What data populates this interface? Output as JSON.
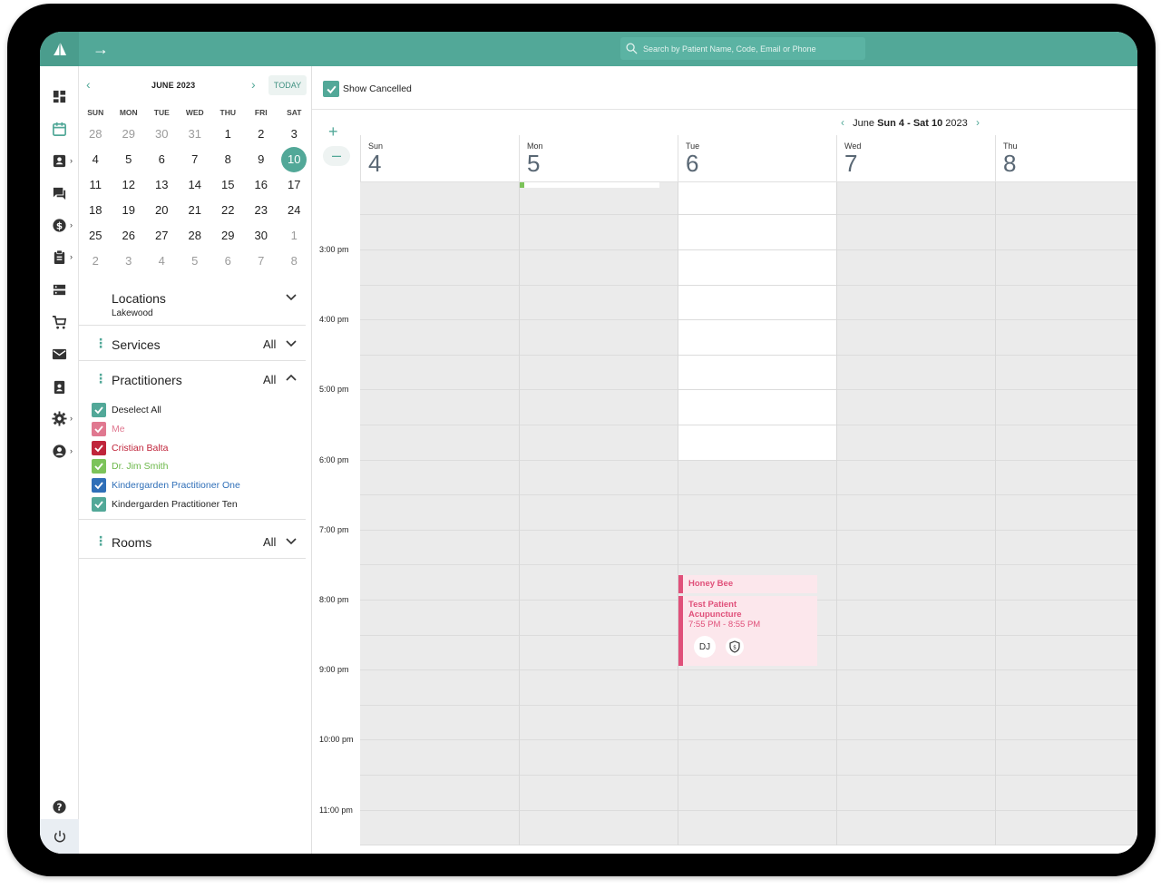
{
  "header": {
    "search_placeholder": "Search by Patient Name, Code, Email or Phone"
  },
  "rail": {
    "icons": [
      "dashboard-icon",
      "calendar-icon",
      "contacts-icon",
      "chat-icon",
      "billing-icon",
      "clipboard-icon",
      "server-icon",
      "cart-icon",
      "mail-icon",
      "badge-icon",
      "gear-icon",
      "account-icon"
    ],
    "help_icon": "help-icon",
    "power_icon": "power-icon"
  },
  "calendar": {
    "month_label": "JUNE 2023",
    "today_label": "TODAY",
    "weekdays": [
      "SUN",
      "MON",
      "TUE",
      "WED",
      "THU",
      "FRI",
      "SAT"
    ],
    "weeks": [
      [
        "28",
        "29",
        "30",
        "31",
        "1",
        "2",
        "3"
      ],
      [
        "4",
        "5",
        "6",
        "7",
        "8",
        "9",
        "10"
      ],
      [
        "11",
        "12",
        "13",
        "14",
        "15",
        "16",
        "17"
      ],
      [
        "18",
        "19",
        "20",
        "21",
        "22",
        "23",
        "24"
      ],
      [
        "25",
        "26",
        "27",
        "28",
        "29",
        "30",
        "1"
      ],
      [
        "2",
        "3",
        "4",
        "5",
        "6",
        "7",
        "8"
      ]
    ],
    "selected": "10"
  },
  "filters": {
    "locations": {
      "title": "Locations",
      "value": "Lakewood"
    },
    "services": {
      "title": "Services",
      "value": "All"
    },
    "practitioners": {
      "title": "Practitioners",
      "value": "All",
      "items": [
        {
          "label": "Deselect All",
          "color": "#52a898",
          "text_color": "#222222"
        },
        {
          "label": "Me",
          "color": "#e07890",
          "text_color": "#e07890"
        },
        {
          "label": "Cristian Balta",
          "color": "#c0253b",
          "text_color": "#c0253b"
        },
        {
          "label": "Dr. Jim Smith",
          "color": "#7cc35a",
          "text_color": "#6cb84a"
        },
        {
          "label": "Kindergarden Practitioner One",
          "color": "#2f6fb8",
          "text_color": "#2f6fb8"
        },
        {
          "label": "Kindergarden Practitioner Ten",
          "color": "#52a898",
          "text_color": "#222222"
        }
      ]
    },
    "rooms": {
      "title": "Rooms",
      "value": "All"
    }
  },
  "toolbar": {
    "show_cancelled_label": "Show Cancelled"
  },
  "week": {
    "month": "June",
    "range": "Sun 4 - Sat 10",
    "year": "2023",
    "days": [
      {
        "name": "Sun",
        "date": "4"
      },
      {
        "name": "Mon",
        "date": "5"
      },
      {
        "name": "Tue",
        "date": "6"
      },
      {
        "name": "Wed",
        "date": "7"
      },
      {
        "name": "Thu",
        "date": "8"
      }
    ]
  },
  "times": [
    "3:00 pm",
    "4:00 pm",
    "5:00 pm",
    "6:00 pm",
    "7:00 pm",
    "8:00 pm",
    "9:00 pm",
    "10:00 pm",
    "11:00 pm"
  ],
  "appointments": [
    {
      "title": "Honey Bee"
    },
    {
      "title": "Test Patient",
      "service": "Acupuncture",
      "time": "7:55 PM - 8:55 PM",
      "initials": "DJ"
    }
  ],
  "colors": {
    "brand": "#52a898",
    "appointment": "#e0507a"
  }
}
